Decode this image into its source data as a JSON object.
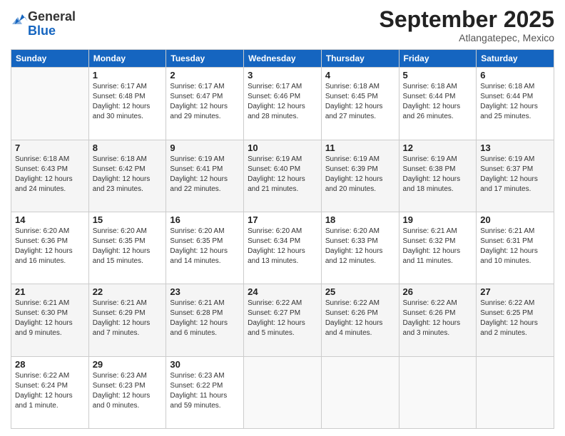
{
  "logo": {
    "general": "General",
    "blue": "Blue"
  },
  "title": "September 2025",
  "location": "Atlangatepec, Mexico",
  "days_header": [
    "Sunday",
    "Monday",
    "Tuesday",
    "Wednesday",
    "Thursday",
    "Friday",
    "Saturday"
  ],
  "weeks": [
    [
      {
        "day": "",
        "info": ""
      },
      {
        "day": "1",
        "info": "Sunrise: 6:17 AM\nSunset: 6:48 PM\nDaylight: 12 hours\nand 30 minutes."
      },
      {
        "day": "2",
        "info": "Sunrise: 6:17 AM\nSunset: 6:47 PM\nDaylight: 12 hours\nand 29 minutes."
      },
      {
        "day": "3",
        "info": "Sunrise: 6:17 AM\nSunset: 6:46 PM\nDaylight: 12 hours\nand 28 minutes."
      },
      {
        "day": "4",
        "info": "Sunrise: 6:18 AM\nSunset: 6:45 PM\nDaylight: 12 hours\nand 27 minutes."
      },
      {
        "day": "5",
        "info": "Sunrise: 6:18 AM\nSunset: 6:44 PM\nDaylight: 12 hours\nand 26 minutes."
      },
      {
        "day": "6",
        "info": "Sunrise: 6:18 AM\nSunset: 6:44 PM\nDaylight: 12 hours\nand 25 minutes."
      }
    ],
    [
      {
        "day": "7",
        "info": "Sunrise: 6:18 AM\nSunset: 6:43 PM\nDaylight: 12 hours\nand 24 minutes."
      },
      {
        "day": "8",
        "info": "Sunrise: 6:18 AM\nSunset: 6:42 PM\nDaylight: 12 hours\nand 23 minutes."
      },
      {
        "day": "9",
        "info": "Sunrise: 6:19 AM\nSunset: 6:41 PM\nDaylight: 12 hours\nand 22 minutes."
      },
      {
        "day": "10",
        "info": "Sunrise: 6:19 AM\nSunset: 6:40 PM\nDaylight: 12 hours\nand 21 minutes."
      },
      {
        "day": "11",
        "info": "Sunrise: 6:19 AM\nSunset: 6:39 PM\nDaylight: 12 hours\nand 20 minutes."
      },
      {
        "day": "12",
        "info": "Sunrise: 6:19 AM\nSunset: 6:38 PM\nDaylight: 12 hours\nand 18 minutes."
      },
      {
        "day": "13",
        "info": "Sunrise: 6:19 AM\nSunset: 6:37 PM\nDaylight: 12 hours\nand 17 minutes."
      }
    ],
    [
      {
        "day": "14",
        "info": "Sunrise: 6:20 AM\nSunset: 6:36 PM\nDaylight: 12 hours\nand 16 minutes."
      },
      {
        "day": "15",
        "info": "Sunrise: 6:20 AM\nSunset: 6:35 PM\nDaylight: 12 hours\nand 15 minutes."
      },
      {
        "day": "16",
        "info": "Sunrise: 6:20 AM\nSunset: 6:35 PM\nDaylight: 12 hours\nand 14 minutes."
      },
      {
        "day": "17",
        "info": "Sunrise: 6:20 AM\nSunset: 6:34 PM\nDaylight: 12 hours\nand 13 minutes."
      },
      {
        "day": "18",
        "info": "Sunrise: 6:20 AM\nSunset: 6:33 PM\nDaylight: 12 hours\nand 12 minutes."
      },
      {
        "day": "19",
        "info": "Sunrise: 6:21 AM\nSunset: 6:32 PM\nDaylight: 12 hours\nand 11 minutes."
      },
      {
        "day": "20",
        "info": "Sunrise: 6:21 AM\nSunset: 6:31 PM\nDaylight: 12 hours\nand 10 minutes."
      }
    ],
    [
      {
        "day": "21",
        "info": "Sunrise: 6:21 AM\nSunset: 6:30 PM\nDaylight: 12 hours\nand 9 minutes."
      },
      {
        "day": "22",
        "info": "Sunrise: 6:21 AM\nSunset: 6:29 PM\nDaylight: 12 hours\nand 7 minutes."
      },
      {
        "day": "23",
        "info": "Sunrise: 6:21 AM\nSunset: 6:28 PM\nDaylight: 12 hours\nand 6 minutes."
      },
      {
        "day": "24",
        "info": "Sunrise: 6:22 AM\nSunset: 6:27 PM\nDaylight: 12 hours\nand 5 minutes."
      },
      {
        "day": "25",
        "info": "Sunrise: 6:22 AM\nSunset: 6:26 PM\nDaylight: 12 hours\nand 4 minutes."
      },
      {
        "day": "26",
        "info": "Sunrise: 6:22 AM\nSunset: 6:26 PM\nDaylight: 12 hours\nand 3 minutes."
      },
      {
        "day": "27",
        "info": "Sunrise: 6:22 AM\nSunset: 6:25 PM\nDaylight: 12 hours\nand 2 minutes."
      }
    ],
    [
      {
        "day": "28",
        "info": "Sunrise: 6:22 AM\nSunset: 6:24 PM\nDaylight: 12 hours\nand 1 minute."
      },
      {
        "day": "29",
        "info": "Sunrise: 6:23 AM\nSunset: 6:23 PM\nDaylight: 12 hours\nand 0 minutes."
      },
      {
        "day": "30",
        "info": "Sunrise: 6:23 AM\nSunset: 6:22 PM\nDaylight: 11 hours\nand 59 minutes."
      },
      {
        "day": "",
        "info": ""
      },
      {
        "day": "",
        "info": ""
      },
      {
        "day": "",
        "info": ""
      },
      {
        "day": "",
        "info": ""
      }
    ]
  ]
}
